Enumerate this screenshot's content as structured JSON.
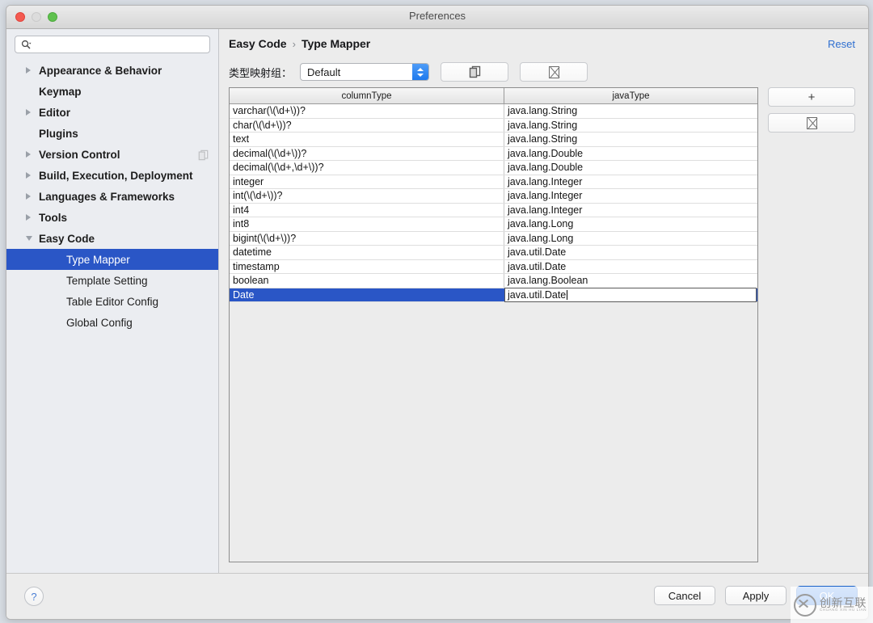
{
  "window": {
    "title": "Preferences",
    "controls": {
      "close": "close-button",
      "minimize": "minimize-button",
      "zoom": "zoom-button"
    }
  },
  "sidebar": {
    "search": {
      "value": "",
      "placeholder": ""
    },
    "items": [
      {
        "label": "Appearance & Behavior",
        "arrow": "right",
        "level": 0,
        "selected": false,
        "side_icon": false
      },
      {
        "label": "Keymap",
        "arrow": "none",
        "level": 0,
        "selected": false,
        "side_icon": false
      },
      {
        "label": "Editor",
        "arrow": "right",
        "level": 0,
        "selected": false,
        "side_icon": false
      },
      {
        "label": "Plugins",
        "arrow": "none",
        "level": 0,
        "selected": false,
        "side_icon": false
      },
      {
        "label": "Version Control",
        "arrow": "right",
        "level": 0,
        "selected": false,
        "side_icon": true
      },
      {
        "label": "Build, Execution, Deployment",
        "arrow": "right",
        "level": 0,
        "selected": false,
        "side_icon": false
      },
      {
        "label": "Languages & Frameworks",
        "arrow": "right",
        "level": 0,
        "selected": false,
        "side_icon": false
      },
      {
        "label": "Tools",
        "arrow": "right",
        "level": 0,
        "selected": false,
        "side_icon": false
      },
      {
        "label": "Easy Code",
        "arrow": "down",
        "level": 0,
        "selected": false,
        "side_icon": false
      },
      {
        "label": "Type Mapper",
        "arrow": "none",
        "level": 1,
        "selected": true,
        "side_icon": false
      },
      {
        "label": "Template Setting",
        "arrow": "none",
        "level": 1,
        "selected": false,
        "side_icon": false
      },
      {
        "label": "Table Editor Config",
        "arrow": "none",
        "level": 1,
        "selected": false,
        "side_icon": false
      },
      {
        "label": "Global Config",
        "arrow": "none",
        "level": 1,
        "selected": false,
        "side_icon": false
      }
    ]
  },
  "main": {
    "breadcrumb": {
      "root": "Easy Code",
      "separator": "›",
      "current": "Type Mapper"
    },
    "reset_label": "Reset",
    "toolbar": {
      "group_label": "类型映射组：",
      "group_value": "Default",
      "copy_button": "copy-group-button",
      "delete_button": "delete-group-button"
    },
    "table": {
      "columns": [
        "columnType",
        "javaType"
      ],
      "rows": [
        {
          "columnType": "varchar(\\(\\d+\\))?",
          "javaType": "java.lang.String",
          "selected": false,
          "editing": false
        },
        {
          "columnType": "char(\\(\\d+\\))?",
          "javaType": "java.lang.String",
          "selected": false,
          "editing": false
        },
        {
          "columnType": "text",
          "javaType": "java.lang.String",
          "selected": false,
          "editing": false
        },
        {
          "columnType": "decimal(\\(\\d+\\))?",
          "javaType": "java.lang.Double",
          "selected": false,
          "editing": false
        },
        {
          "columnType": "decimal(\\(\\d+,\\d+\\))?",
          "javaType": "java.lang.Double",
          "selected": false,
          "editing": false
        },
        {
          "columnType": "integer",
          "javaType": "java.lang.Integer",
          "selected": false,
          "editing": false
        },
        {
          "columnType": "int(\\(\\d+\\))?",
          "javaType": "java.lang.Integer",
          "selected": false,
          "editing": false
        },
        {
          "columnType": "int4",
          "javaType": "java.lang.Integer",
          "selected": false,
          "editing": false
        },
        {
          "columnType": "int8",
          "javaType": "java.lang.Long",
          "selected": false,
          "editing": false
        },
        {
          "columnType": "bigint(\\(\\d+\\))?",
          "javaType": "java.lang.Long",
          "selected": false,
          "editing": false
        },
        {
          "columnType": "datetime",
          "javaType": "java.util.Date",
          "selected": false,
          "editing": false
        },
        {
          "columnType": "timestamp",
          "javaType": "java.util.Date",
          "selected": false,
          "editing": false
        },
        {
          "columnType": "boolean",
          "javaType": "java.lang.Boolean",
          "selected": false,
          "editing": false
        },
        {
          "columnType": "Date",
          "javaType": "java.util.Date",
          "selected": true,
          "editing": true
        }
      ]
    },
    "side_buttons": {
      "add_label": "+",
      "remove_label": "remove-icon"
    }
  },
  "footer": {
    "help_label": "?",
    "cancel_label": "Cancel",
    "apply_label": "Apply",
    "ok_label": "OK"
  },
  "watermark": {
    "cn": "创新互联",
    "en": "CHUANG XIN HU LIAN"
  },
  "colors": {
    "selection_blue": "#2a56c6",
    "accent_blue": "#2f6fd0",
    "window_bg": "#ececec",
    "sidebar_bg": "#ebedf1"
  }
}
